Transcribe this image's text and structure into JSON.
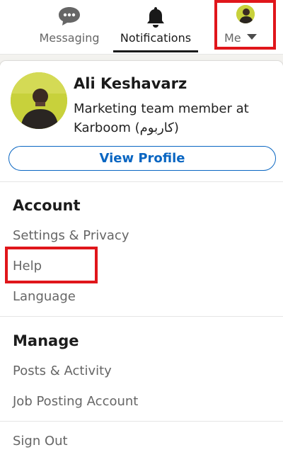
{
  "nav": {
    "messaging_label": "Messaging",
    "notifications_label": "Notifications",
    "me_label": "Me"
  },
  "profile": {
    "name": "Ali Keshavarz",
    "headline": "Marketing team member at Karboom (کاربوم)",
    "view_profile_label": "View Profile"
  },
  "account": {
    "heading": "Account",
    "items": [
      "Settings & Privacy",
      "Help",
      "Language"
    ]
  },
  "manage": {
    "heading": "Manage",
    "items": [
      "Posts & Activity",
      "Job Posting Account"
    ]
  },
  "sign_out_label": "Sign Out",
  "colors": {
    "brand_blue": "#0a66c2",
    "highlight_red": "#e0161b",
    "avatar_bg": "#c8d13b"
  },
  "icons": {
    "messaging": "speech-bubble-icon",
    "notifications": "bell-icon",
    "me_caret": "caret-down-icon"
  }
}
